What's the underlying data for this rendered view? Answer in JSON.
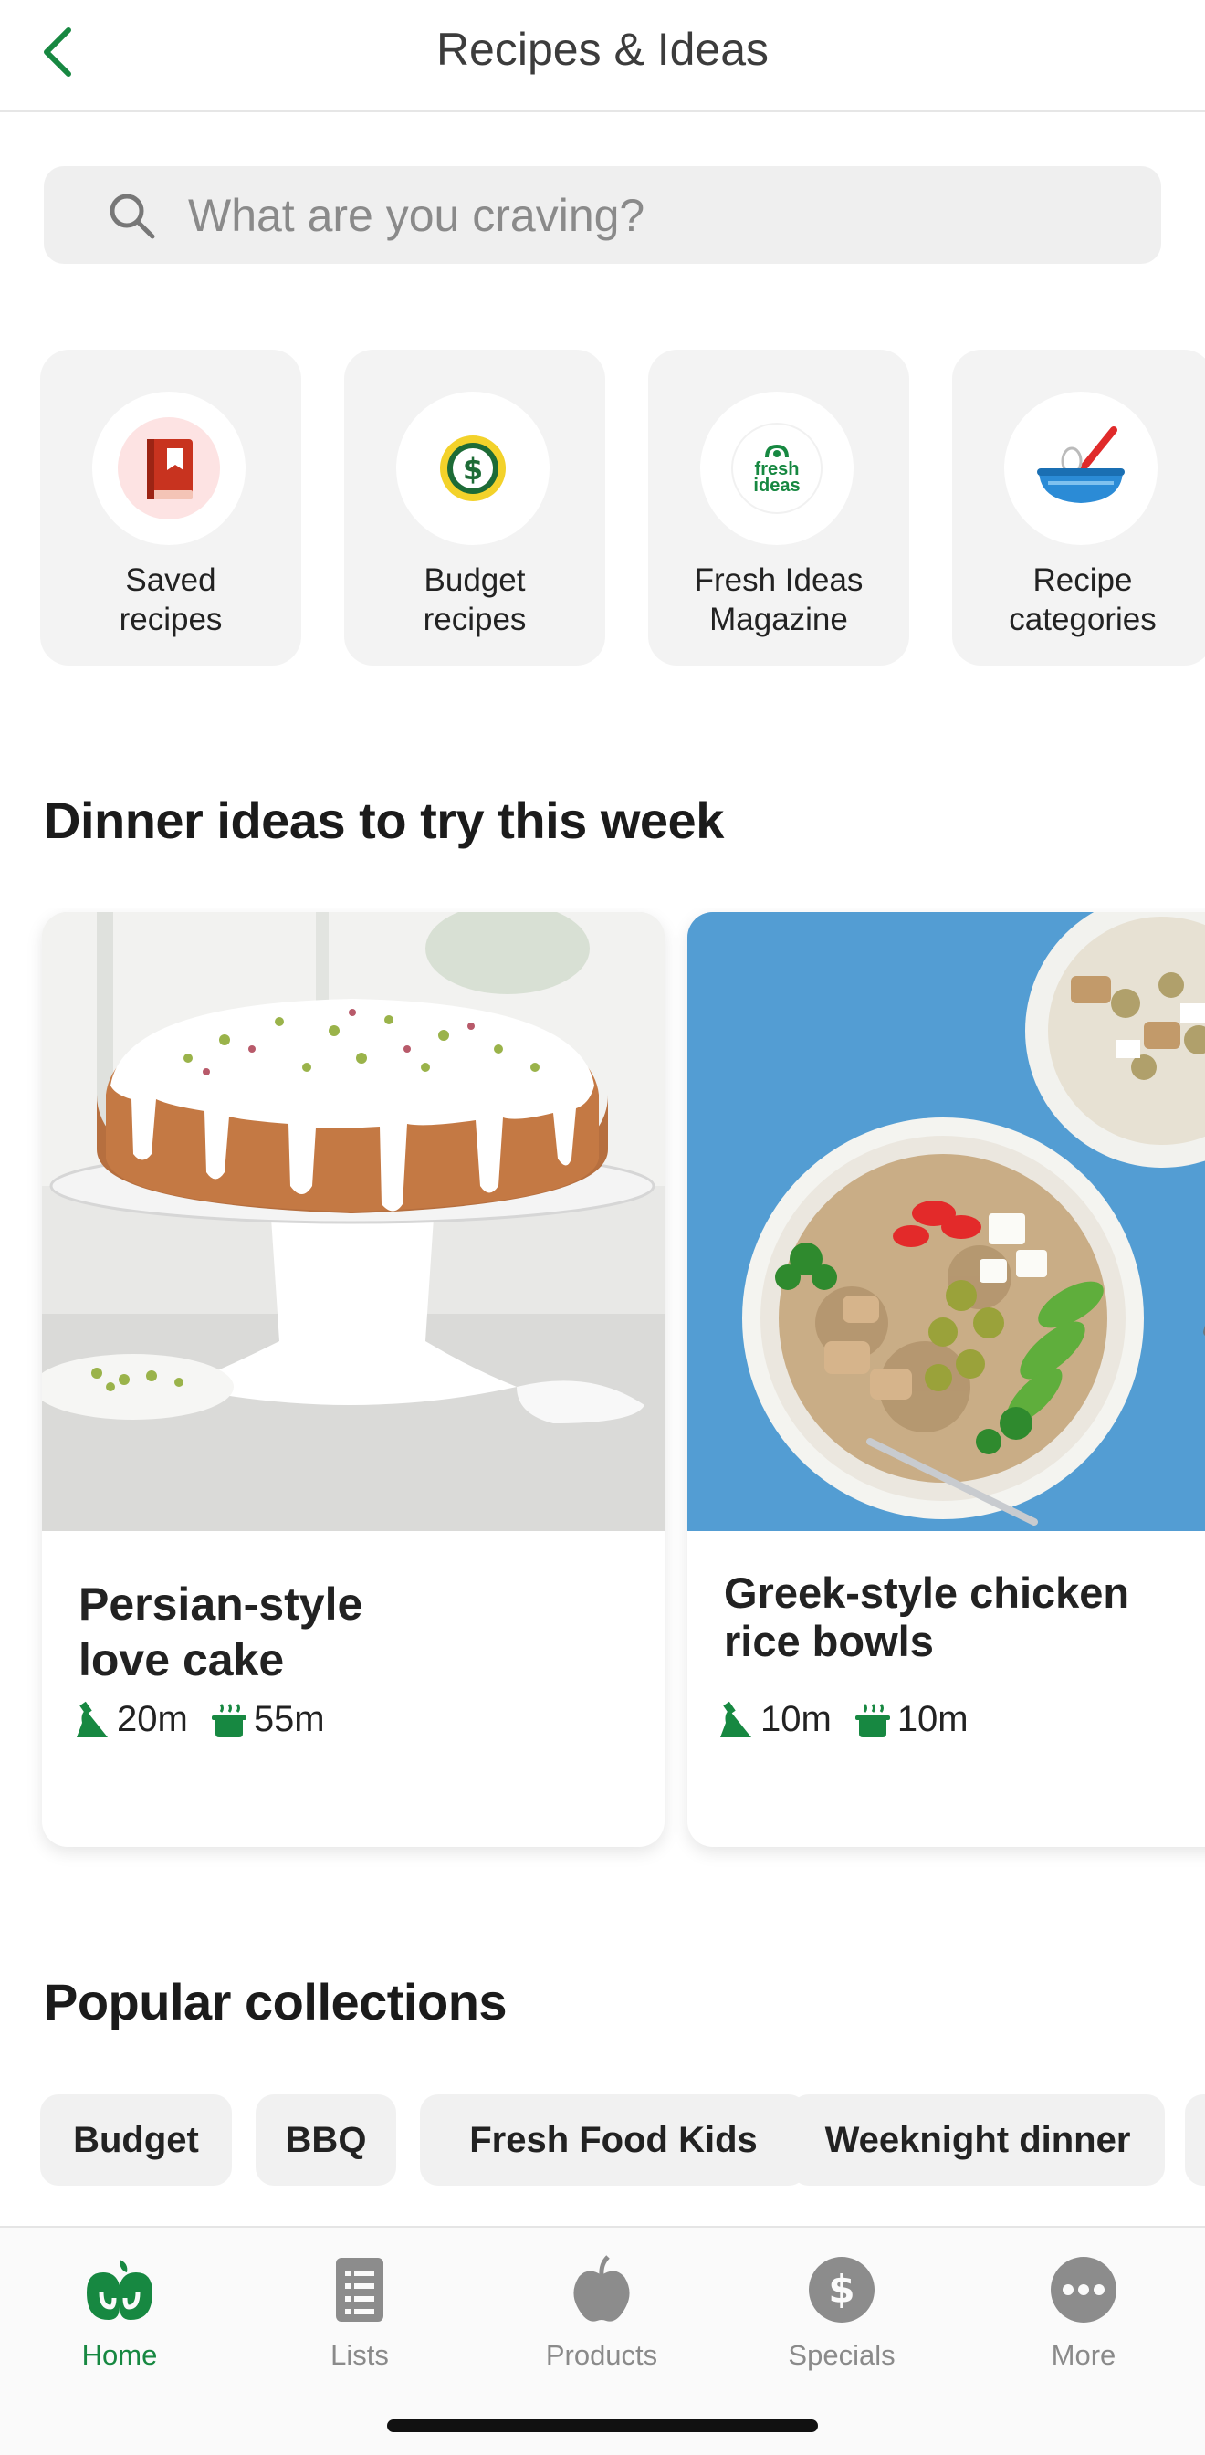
{
  "header": {
    "title": "Recipes & Ideas"
  },
  "search": {
    "placeholder": "What are you craving?"
  },
  "shortcuts": [
    {
      "label": "Saved\nrecipes",
      "icon": "saved-book-icon"
    },
    {
      "label": "Budget\nrecipes",
      "icon": "dollar-coin-icon"
    },
    {
      "label": "Fresh Ideas\nMagazine",
      "icon": "fresh-ideas-logo",
      "logo_text": "fresh\nideas"
    },
    {
      "label": "Recipe\ncategories",
      "icon": "mixing-bowl-icon"
    }
  ],
  "dinner": {
    "title": "Dinner ideas to try this week",
    "recipes": [
      {
        "title": "Persian-style\nlove cake",
        "prep": "20m",
        "cook": "55m"
      },
      {
        "title": "Greek-style chicken\nrice bowls",
        "prep": "10m",
        "cook": "10m"
      }
    ]
  },
  "collections": {
    "title": "Popular collections",
    "chips": [
      "Budget",
      "BBQ",
      "Fresh Food Kids",
      "Weeknight dinner"
    ]
  },
  "nav": [
    {
      "label": "Home",
      "icon": "woolworths-home-icon",
      "active": true
    },
    {
      "label": "Lists",
      "icon": "list-icon",
      "active": false
    },
    {
      "label": "Products",
      "icon": "apple-icon",
      "active": false
    },
    {
      "label": "Specials",
      "icon": "dollar-badge-icon",
      "active": false
    },
    {
      "label": "More",
      "icon": "more-dots-icon",
      "active": false
    }
  ],
  "colors": {
    "brand_green": "#178841",
    "search_bg": "#efefef",
    "tile_bg": "#f3f3f3"
  }
}
